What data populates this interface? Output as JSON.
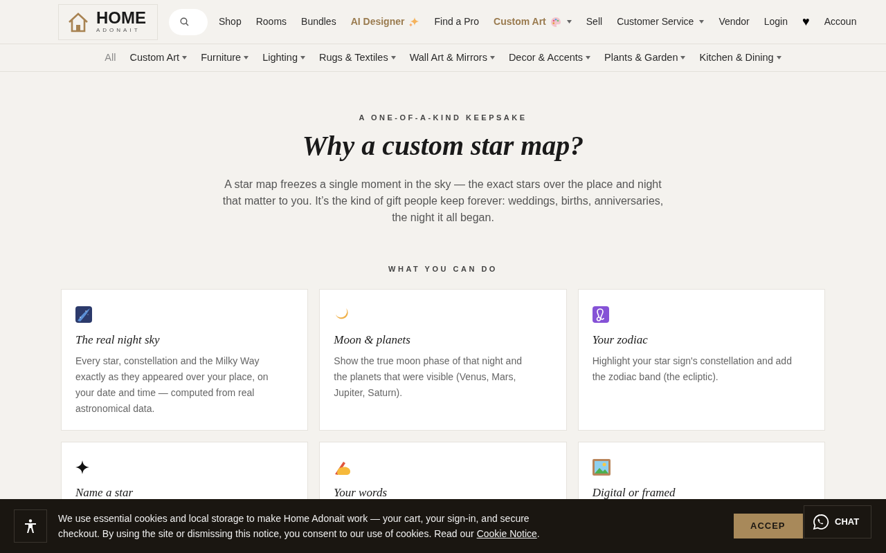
{
  "header": {
    "logo": {
      "name": "HOME",
      "tagline": "ADONAIT"
    },
    "nav": [
      {
        "label": "Shop",
        "kind": "link",
        "dropdown": false
      },
      {
        "label": "Rooms",
        "kind": "link",
        "dropdown": false
      },
      {
        "label": "Bundles",
        "kind": "link",
        "dropdown": false
      },
      {
        "label": "AI Designer",
        "kind": "ai",
        "dropdown": false
      },
      {
        "label": "Find a Pro",
        "kind": "link",
        "dropdown": false
      },
      {
        "label": "Custom Art",
        "kind": "art",
        "dropdown": true
      },
      {
        "label": "Sell",
        "kind": "link",
        "dropdown": false
      },
      {
        "label": "Customer Service",
        "kind": "link",
        "dropdown": true
      },
      {
        "label": "Vendor",
        "kind": "link",
        "dropdown": false
      },
      {
        "label": "Login",
        "kind": "link",
        "dropdown": false
      },
      {
        "label": "♥",
        "kind": "heart",
        "dropdown": false
      },
      {
        "label": "Accoun",
        "kind": "link",
        "dropdown": false
      }
    ]
  },
  "categories": [
    {
      "label": "All",
      "selected": true,
      "dropdown": false
    },
    {
      "label": "Custom Art",
      "selected": false,
      "dropdown": true
    },
    {
      "label": "Furniture",
      "selected": false,
      "dropdown": true
    },
    {
      "label": "Lighting",
      "selected": false,
      "dropdown": true
    },
    {
      "label": "Rugs & Textiles",
      "selected": false,
      "dropdown": true
    },
    {
      "label": "Wall Art & Mirrors",
      "selected": false,
      "dropdown": true
    },
    {
      "label": "Decor & Accents",
      "selected": false,
      "dropdown": true
    },
    {
      "label": "Plants & Garden",
      "selected": false,
      "dropdown": true
    },
    {
      "label": "Kitchen & Dining",
      "selected": false,
      "dropdown": true
    }
  ],
  "hero": {
    "eyebrow": "A ONE-OF-A-KIND KEEPSAKE",
    "title": "Why a custom star map?",
    "text": "A star map freezes a single moment in the sky — the exact stars over the place and night that matter to you. It’s the kind of gift people keep forever: weddings, births, anniversaries, the night it all began."
  },
  "features": {
    "heading": "WHAT YOU CAN DO",
    "cards": [
      {
        "title": "The real night sky",
        "text": "Every star, constellation and the Milky Way exactly as they appeared over your place, on your date and time — computed from real astronomical data."
      },
      {
        "title": "Moon & planets",
        "text": "Show the true moon phase of that night and the planets that were visible (Venus, Mars, Jupiter, Saturn)."
      },
      {
        "title": "Your zodiac",
        "text": "Highlight your star sign's constellation and add the zodiac band (the ecliptic)."
      },
      {
        "title": "Name a star"
      },
      {
        "title": "Your words"
      },
      {
        "title": "Digital or framed"
      }
    ]
  },
  "cookie_banner": {
    "text": "We use essential cookies and local storage to make Home Adonait work — your cart, your sign-in, and secure checkout. By using the site or dismissing this notice, you consent to our use of cookies. Read our",
    "link": "Cookie Notice",
    "end": ".",
    "accept": "ACCEP"
  },
  "chat": {
    "label": "CHAT"
  }
}
